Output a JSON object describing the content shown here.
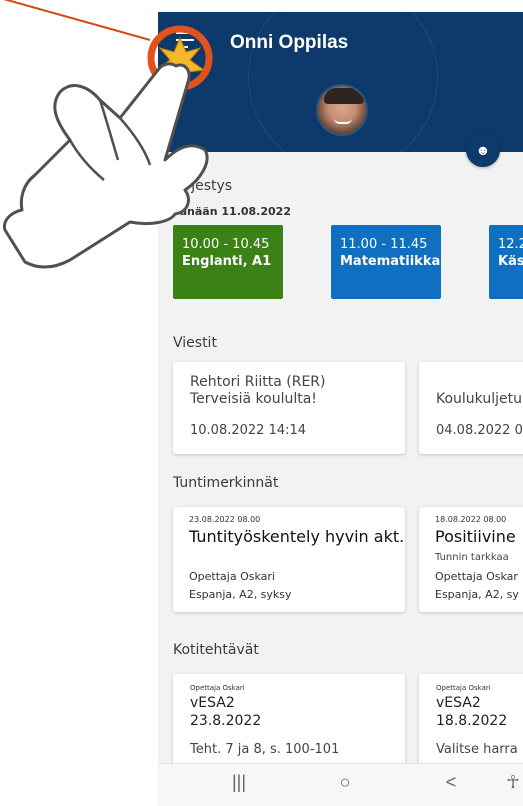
{
  "header": {
    "student_name": "Onni Oppilas"
  },
  "icons": {
    "menu": "menu-icon",
    "avatar": "profile-avatar",
    "fab": "emoji-icon"
  },
  "schedule": {
    "title": "järjestys",
    "date_label": "Tänään 11.08.2022",
    "lessons": [
      {
        "time": "10.00 - 10.45",
        "subject": "Englanti, A1",
        "color": "#3b8216"
      },
      {
        "time": "11.00 - 11.45",
        "subject": "Matematiikka",
        "color": "#0f6fc0"
      },
      {
        "time": "12.2",
        "subject": "Käs",
        "color": "#0f6fc0"
      }
    ]
  },
  "messages": {
    "title": "Viestit",
    "items": [
      {
        "from": "Rehtori Riitta (RER)",
        "subject": "Terveisiä koululta!",
        "date": "10.08.2022 14:14"
      },
      {
        "from": "",
        "subject": "Koulukuljetu",
        "date": "04.08.2022 0"
      }
    ]
  },
  "marks": {
    "title": "Tuntimerkinnät",
    "items": [
      {
        "date": "23.08.2022 08.00",
        "title": "Tuntityöskentely hyvin akt...",
        "subtitle": "",
        "teacher": "Opettaja Oskari",
        "course": "Espanja, A2, syksy"
      },
      {
        "date": "18.08.2022 08.00",
        "title": "Positiivine",
        "subtitle": "Tunnin tarkkaa",
        "teacher": "Opettaja Oskar",
        "course": "Espanja, A2, sy"
      }
    ]
  },
  "homework": {
    "title": "Kotitehtävät",
    "items": [
      {
        "teacher": "Opettaja Oskari",
        "course": "vESA2",
        "date": "23.8.2022",
        "task": "Teht. 7 ja 8, s. 100-101"
      },
      {
        "teacher": "Opettaja Oskari",
        "course": "vESA2",
        "date": "18.8.2022",
        "task": "Valitse harra"
      }
    ]
  },
  "navbar": {
    "recent": "|||",
    "home": "○",
    "back": "<",
    "accessibility": "☥"
  },
  "colors": {
    "header": "#0d3a6b",
    "highlight_circle": "#e2521d",
    "pointer_line": "#d24a12"
  }
}
